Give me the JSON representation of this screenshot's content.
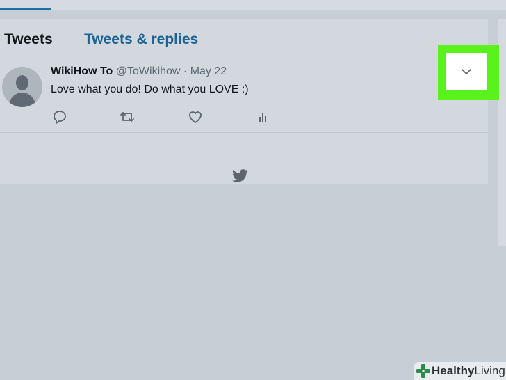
{
  "tabs": {
    "tweets": "Tweets",
    "tweets_replies": "Tweets & replies"
  },
  "tweet": {
    "author_name": "WikiHow To",
    "handle_date": "@ToWikihow · May 22",
    "text": "Love what you do! Do what you LOVE :)",
    "actions": [
      "reply-icon",
      "retweet-icon",
      "like-icon",
      "analytics-icon"
    ],
    "more_icon": "chevron-down-icon"
  },
  "footer_icon": "twitter-bird-icon",
  "colors": {
    "highlight": "#59f21c",
    "link": "#1b6396",
    "overlay_bg": "#c7ced6"
  },
  "watermark": {
    "bold": "Healthy",
    "regular": "Living"
  }
}
